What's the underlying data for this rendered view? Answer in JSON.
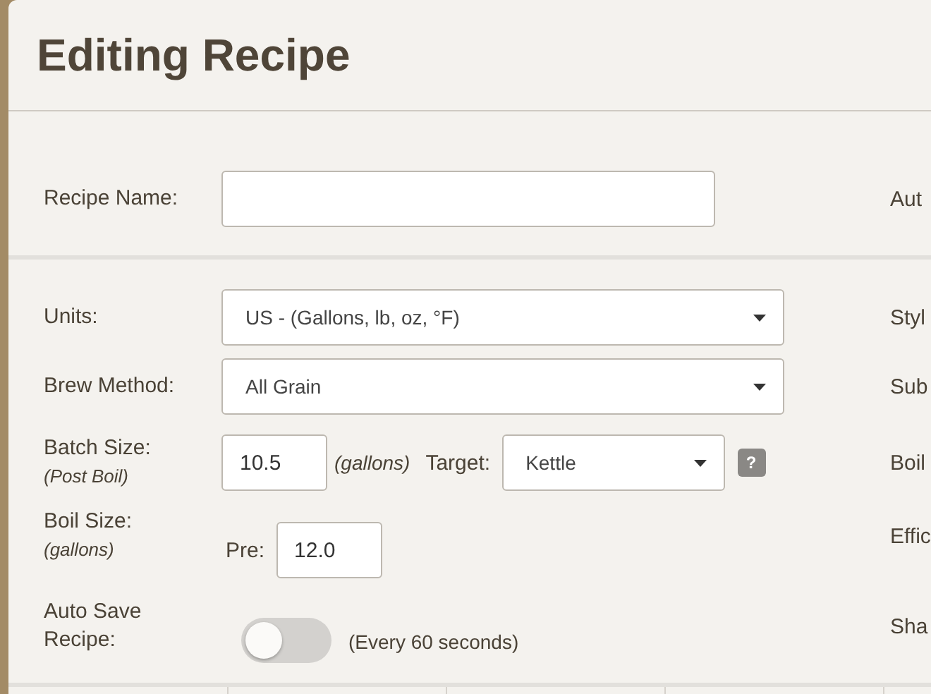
{
  "title": "Editing Recipe",
  "recipe_name": {
    "label": "Recipe Name:",
    "side_label": "Aut"
  },
  "units": {
    "label": "Units:",
    "value": "US - (Gallons, lb, oz, °F)",
    "side_label": "Styl"
  },
  "brew_method": {
    "label": "Brew Method:",
    "value": "All Grain",
    "side_label": "Sub"
  },
  "batch_size": {
    "label": "Batch Size:",
    "note": "(Post Boil)",
    "value": "10.5",
    "unit": "(gallons)",
    "target_label": "Target:",
    "target_value": "Kettle",
    "help": "?",
    "side_label": "Boil"
  },
  "boil_size": {
    "label": "Boil Size:",
    "note": "(gallons)",
    "pre_label": "Pre:",
    "value": "12.0",
    "side_label": "Effic"
  },
  "auto_save": {
    "label": "Auto Save Recipe:",
    "on": false,
    "hint": "(Every 60 seconds)",
    "side_label": "Sha"
  }
}
